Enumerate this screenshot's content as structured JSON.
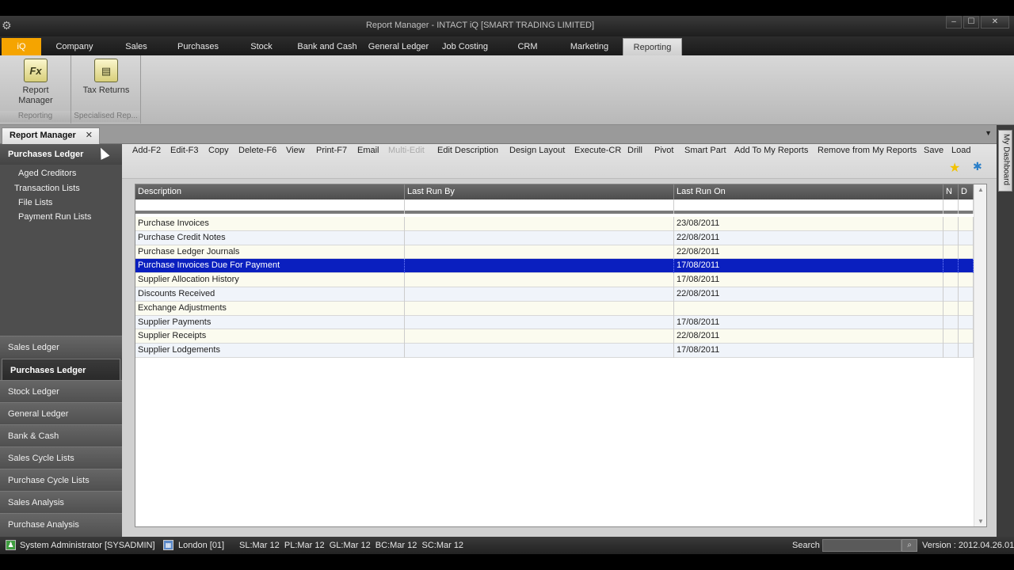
{
  "window": {
    "title": "Report Manager - INTACT iQ [SMART TRADING LIMITED]",
    "minimize": "–",
    "maximize": "☐",
    "close": "✕"
  },
  "ribbon_tabs": [
    {
      "label": "iQ"
    },
    {
      "label": "Company"
    },
    {
      "label": "Sales"
    },
    {
      "label": "Purchases"
    },
    {
      "label": "Stock"
    },
    {
      "label": "Bank and Cash"
    },
    {
      "label": "General Ledger"
    },
    {
      "label": "Job Costing"
    },
    {
      "label": "CRM"
    },
    {
      "label": "Marketing"
    },
    {
      "label": "Reporting"
    }
  ],
  "active_ribbon_tab": "Reporting",
  "ribbon": {
    "groups": [
      {
        "label": "Reporting",
        "buttons": [
          {
            "line1": "Report",
            "line2": "Manager",
            "icon": "Fx"
          }
        ]
      },
      {
        "label": "Specialised Rep...",
        "buttons": [
          {
            "line1": "Tax Returns",
            "icon": "tax-returns-icon"
          }
        ]
      }
    ]
  },
  "doc_tab": {
    "label": "Report Manager",
    "close": "✕",
    "dropdown": "▼"
  },
  "leftnav": {
    "header": "Purchases Ledger",
    "tree": [
      {
        "label": "Aged Creditors"
      },
      {
        "label": "Transaction Lists"
      },
      {
        "label": "File Lists"
      },
      {
        "label": "Payment Run Lists"
      }
    ],
    "buttons": [
      {
        "label": "Sales Ledger"
      },
      {
        "label": "Purchases Ledger"
      },
      {
        "label": "Stock Ledger"
      },
      {
        "label": "General Ledger"
      },
      {
        "label": "Bank & Cash"
      },
      {
        "label": "Sales Cycle Lists"
      },
      {
        "label": "Purchase Cycle Lists"
      },
      {
        "label": "Sales Analysis"
      },
      {
        "label": "Purchase Analysis"
      }
    ],
    "active_button": "Purchases Ledger"
  },
  "toolbar": {
    "buttons": [
      {
        "label": "Add-F2",
        "enabled": true
      },
      {
        "label": "Edit-F3",
        "enabled": true
      },
      {
        "label": "Copy",
        "enabled": true
      },
      {
        "label": "Delete-F6",
        "enabled": true
      },
      {
        "label": "View",
        "enabled": true
      },
      {
        "label": "Print-F7",
        "enabled": true
      },
      {
        "label": "Email",
        "enabled": true
      },
      {
        "label": "Multi-Edit",
        "enabled": false
      },
      {
        "label": "Edit Description",
        "enabled": true
      },
      {
        "label": "Design Layout",
        "enabled": true
      },
      {
        "label": "Execute-CR",
        "enabled": true
      },
      {
        "label": "Drill",
        "enabled": true
      },
      {
        "label": "Pivot",
        "enabled": true
      },
      {
        "label": "Smart Part",
        "enabled": true
      },
      {
        "label": "Add To My Reports",
        "enabled": true
      },
      {
        "label": "Remove from My Reports",
        "enabled": true
      },
      {
        "label": "Save",
        "enabled": true
      },
      {
        "label": "Load",
        "enabled": true
      }
    ]
  },
  "grid": {
    "columns": [
      "Description",
      "Last Run By",
      "Last Run On",
      "N",
      "D"
    ],
    "rows": [
      {
        "description": "Purchase Invoices",
        "last_run_by": "",
        "last_run_on": "23/08/2011"
      },
      {
        "description": "Purchase Credit Notes",
        "last_run_by": "",
        "last_run_on": "22/08/2011"
      },
      {
        "description": "Purchase Ledger Journals",
        "last_run_by": "",
        "last_run_on": "22/08/2011"
      },
      {
        "description": "Purchase Invoices Due For Payment",
        "last_run_by": "",
        "last_run_on": "17/08/2011"
      },
      {
        "description": "Supplier Allocation History",
        "last_run_by": "",
        "last_run_on": "17/08/2011"
      },
      {
        "description": "Discounts Received",
        "last_run_by": "",
        "last_run_on": "22/08/2011"
      },
      {
        "description": "Exchange Adjustments",
        "last_run_by": "",
        "last_run_on": ""
      },
      {
        "description": "Supplier Payments",
        "last_run_by": "",
        "last_run_on": "17/08/2011"
      },
      {
        "description": "Supplier Receipts",
        "last_run_by": "",
        "last_run_on": "22/08/2011"
      },
      {
        "description": "Supplier Lodgements",
        "last_run_by": "",
        "last_run_on": "17/08/2011"
      }
    ],
    "selected_row": 3
  },
  "right_rail": {
    "label": "My Dashboard"
  },
  "status": {
    "user": "System Administrator [SYSADMIN]",
    "location": "London [01]",
    "periods": "SL:Mar 12  PL:Mar 12  GL:Mar 12  BC:Mar 12  SC:Mar 12",
    "search_label": "Search",
    "search_value": "",
    "version": "Version : 2012.04.26.01"
  },
  "colors": {
    "accent": "#f5a400",
    "selection": "#0a1fbf"
  }
}
